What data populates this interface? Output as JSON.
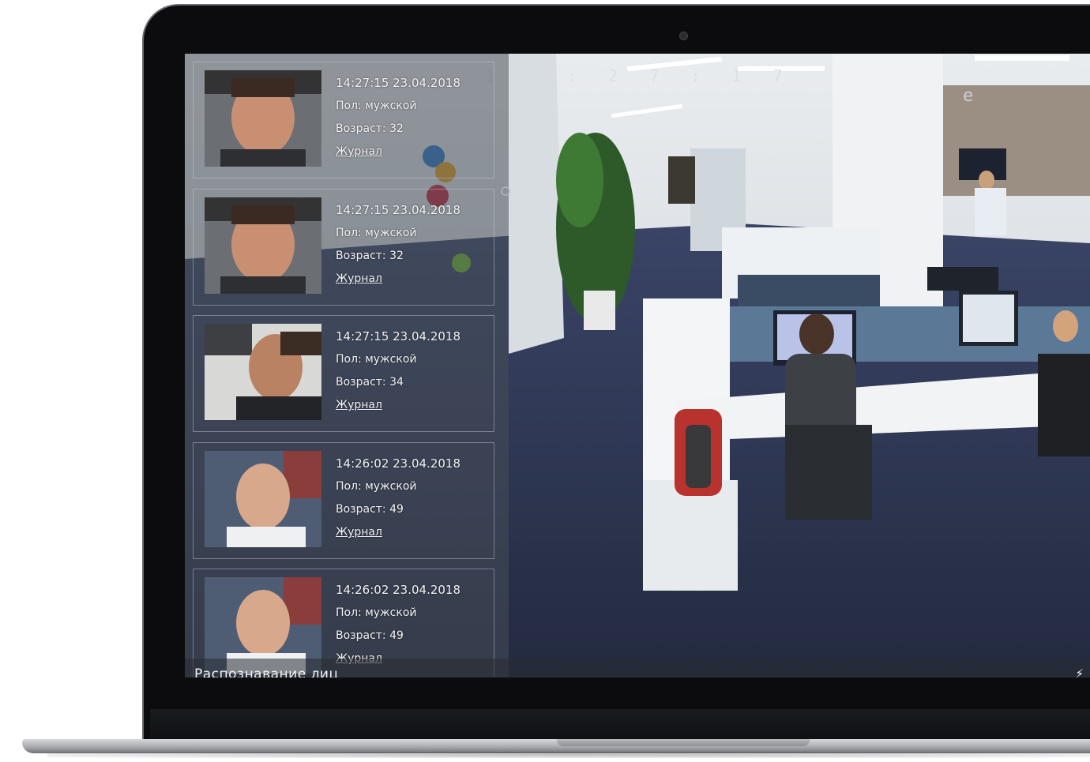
{
  "screen": {
    "clock": "1 2 : 2 7 : 1 7",
    "osd_tag": "C т e"
  },
  "panel": {
    "title": "Распознавание лиц",
    "cards": [
      {
        "time": "14:27:15 23.04.2018",
        "gender": "Пол: мужской",
        "age": "Возраст: 32",
        "log": "Журнал"
      },
      {
        "time": "14:27:15 23.04.2018",
        "gender": "Пол: мужской",
        "age": "Возраст: 32",
        "log": "Журнал"
      },
      {
        "time": "14:27:15 23.04.2018",
        "gender": "Пол: мужской",
        "age": "Возраст: 34",
        "log": "Журнал"
      },
      {
        "time": "14:26:02 23.04.2018",
        "gender": "Пол: мужской",
        "age": "Возраст: 49",
        "log": "Журнал"
      },
      {
        "time": "14:26:02 23.04.2018",
        "gender": "Пол: мужской",
        "age": "Возраст: 49",
        "log": "Журнал"
      }
    ]
  },
  "icons": {
    "flash": "lightning-icon",
    "camera": "camera-icon"
  },
  "colors": {
    "panel_overlay": "#464c56",
    "carpet": "#2c3450",
    "bezel": "#0c0c0e"
  }
}
